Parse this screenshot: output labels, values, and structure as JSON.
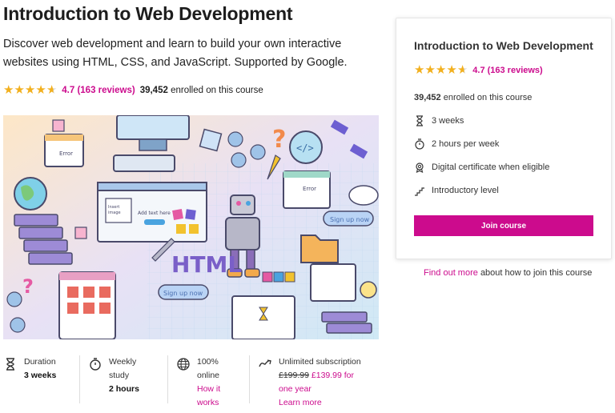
{
  "course": {
    "title": "Introduction to Web Development",
    "description": "Discover web development and learn to build your own interactive websites using HTML, CSS, and JavaScript. Supported by Google.",
    "rating_text": "4.7 (163 reviews)",
    "rating_value": 4.7,
    "enrolled_count": "39,452",
    "enrolled_suffix": "enrolled on this course"
  },
  "hero": {
    "text_html": "HTML",
    "text_add_here": "Add text here",
    "text_error": "Error",
    "text_sign_up": "Sign up now",
    "text_image": "Insert image"
  },
  "stats": [
    {
      "icon": "hourglass-icon",
      "label": "Duration",
      "value": "3 weeks"
    },
    {
      "icon": "stopwatch-icon",
      "label": "Weekly study",
      "value": "2 hours"
    },
    {
      "icon": "globe-icon",
      "label": "100% online",
      "link": "How it works"
    },
    {
      "icon": "infinity-icon",
      "label": "Unlimited subscription",
      "old_price": "£199.99",
      "new_price": "£139.99 for one year",
      "link": "Learn more"
    }
  ],
  "card": {
    "title": "Introduction to Web Development",
    "rating_text": "4.7 (163 reviews)",
    "enrolled_count": "39,452",
    "enrolled_suffix": "enrolled on this course",
    "features": [
      {
        "icon": "hourglass-icon",
        "text": "3 weeks"
      },
      {
        "icon": "stopwatch-icon",
        "text": "2 hours per week"
      },
      {
        "icon": "certificate-icon",
        "text": "Digital certificate when eligible"
      },
      {
        "icon": "steps-icon",
        "text": "Introductory level"
      }
    ],
    "join_label": "Join course"
  },
  "find_out": {
    "link": "Find out more",
    "rest": "about how to join this course"
  },
  "colors": {
    "accent": "#cc0b8d",
    "star": "#f2b01e"
  }
}
